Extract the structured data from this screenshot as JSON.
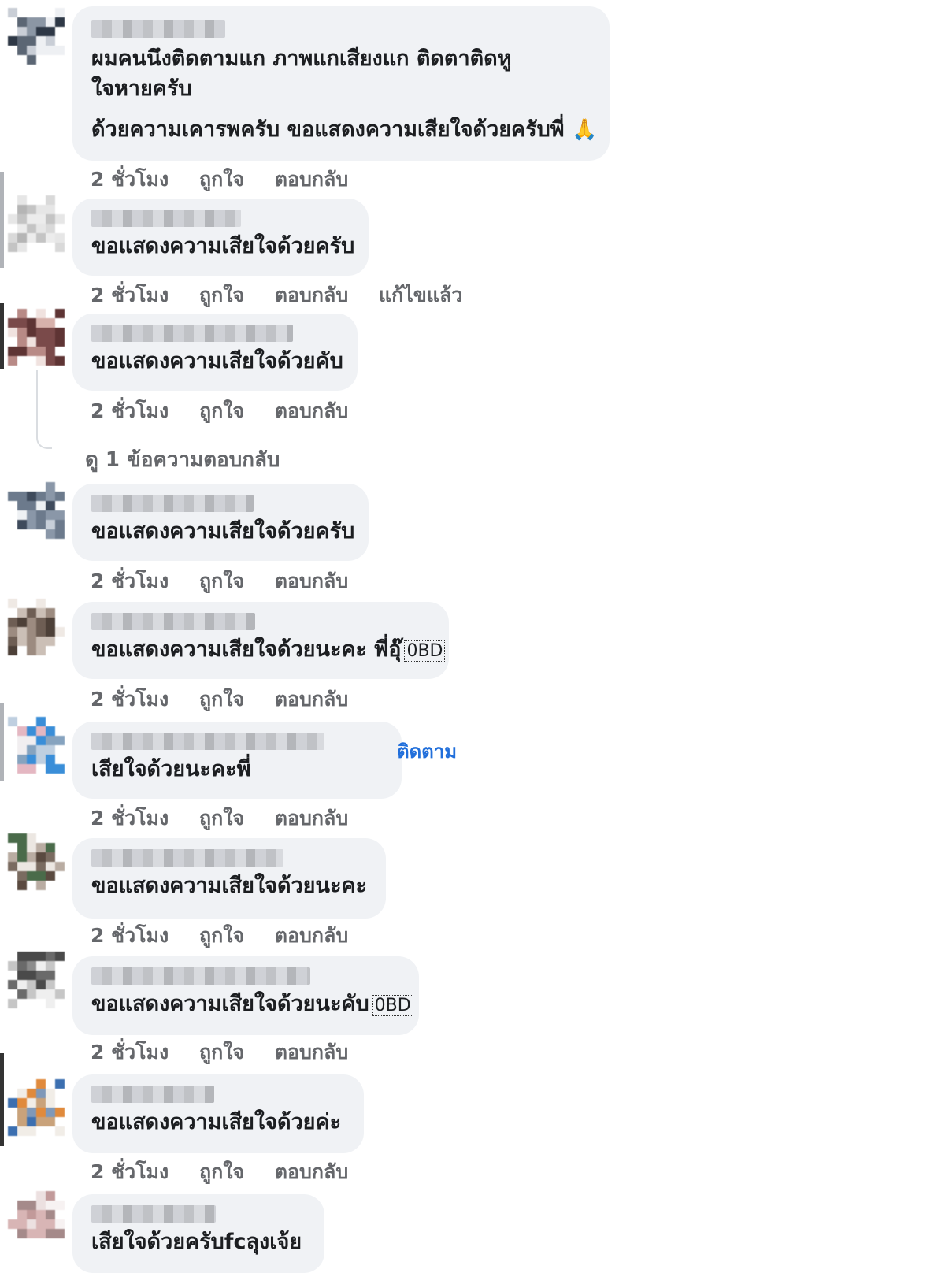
{
  "actions": {
    "time": "2 ชั่วโมง",
    "like": "ถูกใจ",
    "reply": "ตอบกลับ",
    "edited": "แก้ไขแล้ว"
  },
  "view_replies": "ดู 1 ข้อความตอบกลับ",
  "comments": [
    {
      "lines": [
        "ผมคนนึงติดตามแก ภาพแกเสียงแก ติดตาติดหู",
        "ใจหายครับ",
        "ด้วยความเคารพครับ ขอแสดงความเสียใจด้วยครับพี่"
      ],
      "emoji": "🙏",
      "icon": "folded-hands-icon"
    },
    {
      "lines": [
        "ขอแสดงความเสียใจด้วยครับ"
      ],
      "edited": true
    },
    {
      "lines": [
        "ขอแสดงความเสียใจด้วยคับ"
      ],
      "has_replies": true
    },
    {
      "lines": [
        "ขอแสดงความเสียใจด้วยครับ"
      ]
    },
    {
      "lines": [
        "ขอแสดงความเสียใจด้วยนะคะ พี่อุ๊"
      ],
      "glyph": "0BD"
    },
    {
      "lines": [
        "เสียใจด้วยนะคะพี่"
      ],
      "follow": "ติดตาม"
    },
    {
      "lines": [
        "ขอแสดงความเสียใจด้วยนะคะ"
      ]
    },
    {
      "lines": [
        "ขอแสดงความเสียใจด้วยนะคับ"
      ],
      "glyph": "0BD"
    },
    {
      "lines": [
        "ขอแสดงความเสียใจด้วยค่ะ"
      ]
    },
    {
      "lines": [
        "เสียใจด้วยครับfcลุงเจ้ย"
      ]
    }
  ],
  "colors": {
    "bubble": "#f0f2f5",
    "meta": "#65676b",
    "link": "#216fdb",
    "text": "#1c1e21"
  }
}
